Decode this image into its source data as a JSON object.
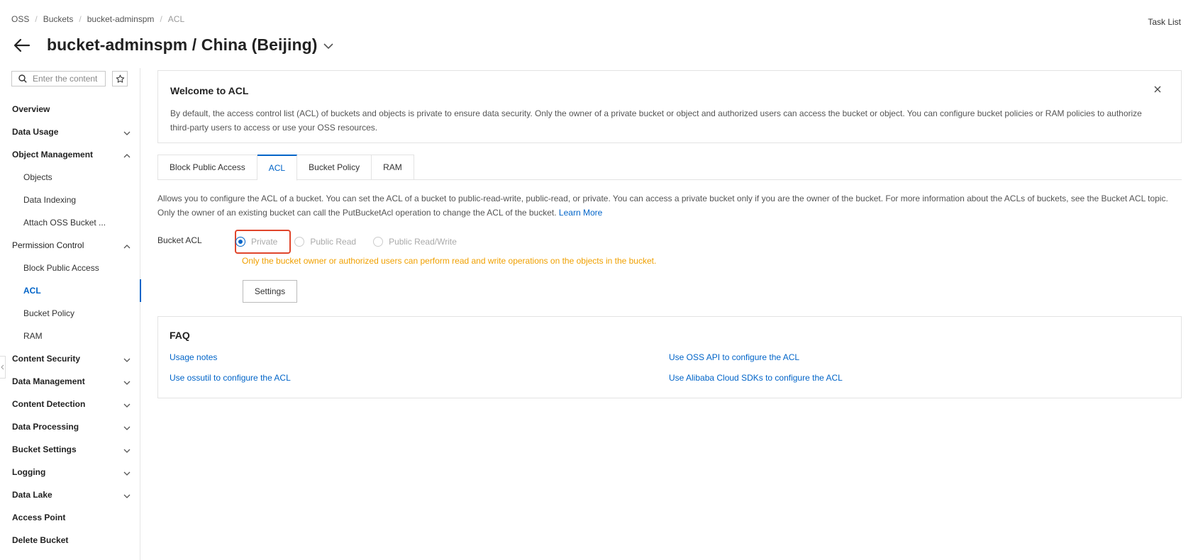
{
  "breadcrumb": [
    "OSS",
    "Buckets",
    "bucket-adminspm",
    "ACL"
  ],
  "header": {
    "title": "bucket-adminspm / China (Beijing)",
    "task_list": "Task List"
  },
  "sidebar": {
    "search_placeholder": "Enter the content",
    "items": [
      {
        "label": "Overview",
        "level": "top",
        "chevron": "none"
      },
      {
        "label": "Data Usage",
        "level": "top",
        "chevron": "down"
      },
      {
        "label": "Object Management",
        "level": "top",
        "chevron": "up"
      },
      {
        "label": "Objects",
        "level": "sub"
      },
      {
        "label": "Data Indexing",
        "level": "sub"
      },
      {
        "label": "Attach OSS Bucket ...",
        "level": "sub"
      },
      {
        "label": "Permission Control",
        "level": "group",
        "chevron": "up"
      },
      {
        "label": "Block Public Access",
        "level": "sub"
      },
      {
        "label": "ACL",
        "level": "sub",
        "active": true
      },
      {
        "label": "Bucket Policy",
        "level": "sub"
      },
      {
        "label": "RAM",
        "level": "sub"
      },
      {
        "label": "Content Security",
        "level": "top",
        "chevron": "down"
      },
      {
        "label": "Data Management",
        "level": "top",
        "chevron": "down"
      },
      {
        "label": "Content Detection",
        "level": "top",
        "chevron": "down"
      },
      {
        "label": "Data Processing",
        "level": "top",
        "chevron": "down"
      },
      {
        "label": "Bucket Settings",
        "level": "top",
        "chevron": "down"
      },
      {
        "label": "Logging",
        "level": "top",
        "chevron": "down"
      },
      {
        "label": "Data Lake",
        "level": "top",
        "chevron": "down"
      },
      {
        "label": "Access Point",
        "level": "top",
        "chevron": "none"
      },
      {
        "label": "Delete Bucket",
        "level": "top",
        "chevron": "none"
      }
    ]
  },
  "welcome": {
    "title": "Welcome to ACL",
    "text": "By default, the access control list (ACL) of buckets and objects is private to ensure data security. Only the owner of a private bucket or object and authorized users can access the bucket or object. You can configure bucket policies or RAM policies to authorize third-party users to access or use your OSS resources."
  },
  "tabs": [
    "Block Public Access",
    "ACL",
    "Bucket Policy",
    "RAM"
  ],
  "active_tab": "ACL",
  "acl": {
    "description": "Allows you to configure the ACL of a bucket. You can set the ACL of a bucket to public-read-write, public-read, or private. You can access a private bucket only if you are the owner of the bucket. For more information about the ACLs of buckets, see the Bucket ACL topic. Only the owner of an existing bucket can call the PutBucketAcl operation to change the ACL of the bucket.",
    "learn_more": "Learn More",
    "label": "Bucket ACL",
    "options": [
      "Private",
      "Public Read",
      "Public Read/Write"
    ],
    "selected": "Private",
    "hint": "Only the bucket owner or authorized users can perform read and write operations on the objects in the bucket.",
    "settings_button": "Settings"
  },
  "faq": {
    "title": "FAQ",
    "links": [
      "Usage notes",
      "Use ossutil to configure the ACL",
      "Use OSS API to configure the ACL",
      "Use Alibaba Cloud SDKs to configure the ACL"
    ]
  },
  "colors": {
    "accent": "#0064c8",
    "warning": "#f0a000",
    "highlight": "#e0452b"
  }
}
